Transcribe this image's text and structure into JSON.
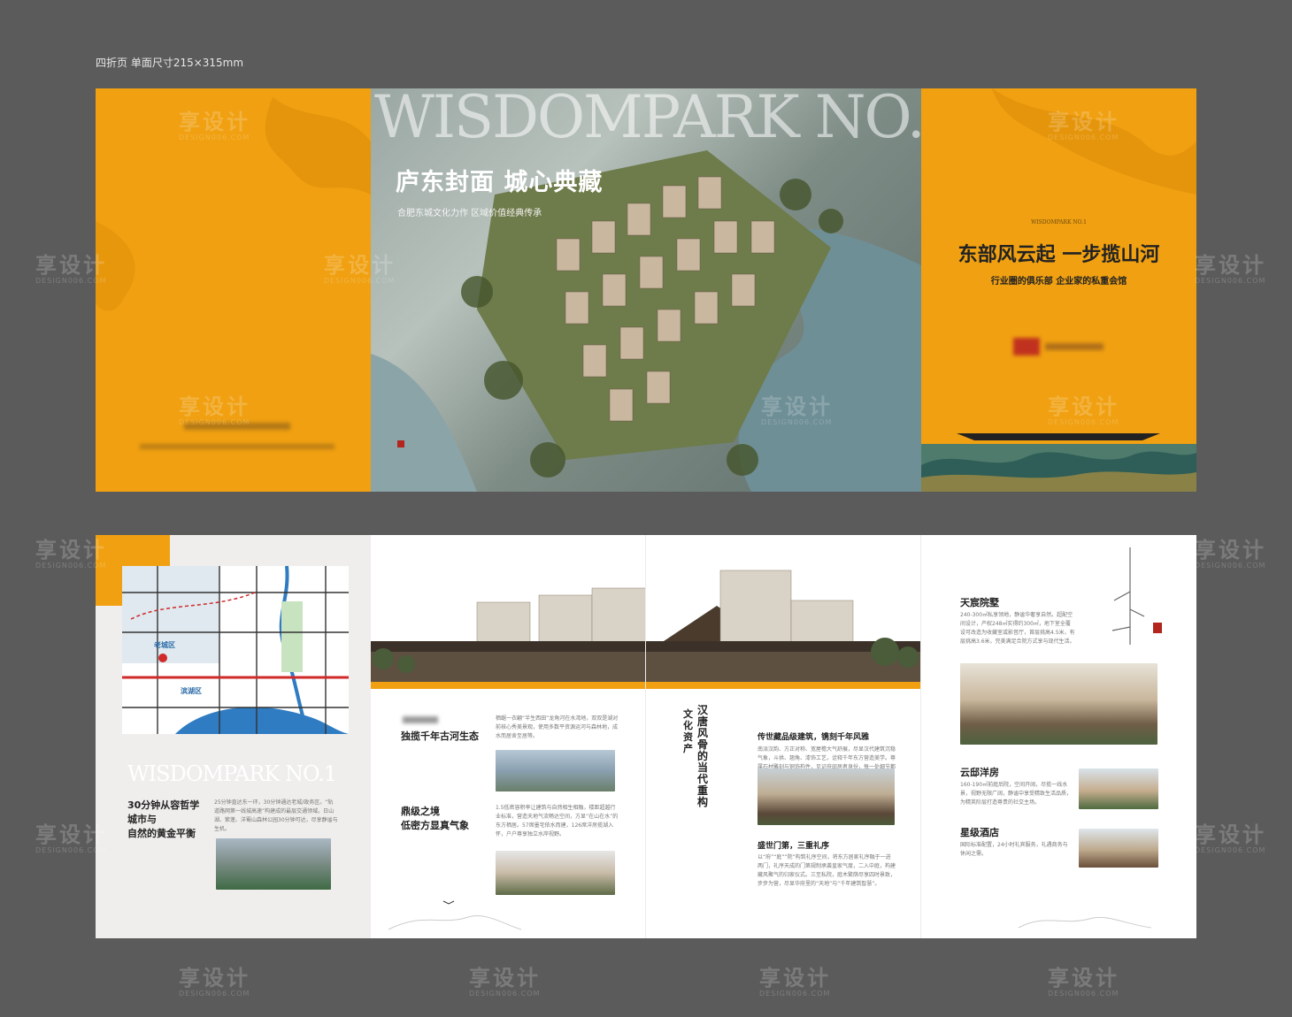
{
  "caption": "四折页 单面尺寸215×315mm",
  "watermark": {
    "text": "享设计",
    "sub": "DESIGN006.COM"
  },
  "cover": {
    "brand": "WISDOMPARK NO.1",
    "headline": "庐东封面 城心典藏",
    "subline": "合肥东城文化力作 区域价值经典传承"
  },
  "back_cover": {
    "small_brand": "WISDOMPARK NO.1",
    "headline": "东部风云起 一步揽山河",
    "subline": "行业圈的俱乐部 企业家的私重会馆"
  },
  "inside": {
    "map_panel": {
      "brand": "WISDOMPARK NO.1",
      "headline_lines": [
        "30分钟从容哲学",
        "城市与",
        "自然的黄金平衡"
      ],
      "paragraph": "25分钟直达东一环，30分钟通达老城/政务区。“轨道路网第一线城高速”构建成的最层交通领域。日山湖、紫蓬、洋蜀山森林公园30分钟可达，尽享静谧与生机。",
      "map_labels": [
        "老城区",
        "滨湖区"
      ]
    },
    "spread_left": {
      "eco_title": "独揽千年古河生态",
      "eco_text": "栖踞一衣翩“半生西田”龙角河在水湾地，双双是湖对前核心秀美景观，使用多数平资源运河与森林地，成水而居舍至居等。",
      "density_title_lines": [
        "鼎级之境",
        "低密方显真气象"
      ],
      "density_text": "1.5低密容积率让建筑与自然相生相融，楼距超越行业标准，营造天地气流畅达空间，方显“在山在水”的东方栖居。57席墨宅依水而建，126席洋房揽湖入怀，户户尊享独立水岸视野。"
    },
    "spread_right": {
      "vertical_title": "汉唐风骨的当代重构",
      "vertical_sub": "文化资产",
      "heritage_title": "传世藏品级建筑，镌刻千年风雅",
      "heritage_text": "南派汉韵、方正对称、宽屋檐大气舒展，尽显汉代建筑沉稳气象，斗拱、翘角、漆饰工艺，诠释千年东方营造美学。尊属石材雕刻与铜饰构件，见证府邸居者身份，每一处细节都蕴藏匠心与时间的积淀。",
      "gate_title": "盛世门第，三重礼序",
      "gate_text": "以“府”“庭”“院”构筑礼序空间，将东方居家礼序融于一进两门，礼序天成的门第规制承袭皇家气度，二入中庭，构建藏风聚气的归家仪式。三至私院，庭木繁荫尽享四时景致，步步为营，尽显华府里的“天地”与“千年建筑智慧”。"
    },
    "products_panel": {
      "villa_title": "天宸院墅",
      "villa_text": "240-300㎡私享领地，静谧华奢享自然。超配空间设计，产权248㎡实得约300㎡，地下室全覆设可改造为收藏室或影音厅，首层挑高4.5米，有层挑高3.6米，完美满足合院方式享与现代生活。",
      "house_title": "云邸洋房",
      "house_text": "160-190㎡前庭后院，空间开阔，尽揽一线水景，视野无限广阔，静谧中享受精致生活品质，为精英阶层打造尊贵的社交主场。",
      "hotel_title": "星级酒店",
      "hotel_text": "国际标准配置，24小时礼宾服务，礼遇商务与休闲之需。"
    }
  },
  "colors": {
    "orange": "#f0a011",
    "grey_bg": "#5b5b5b",
    "map_red": "#d02a2a",
    "water_blue": "#2f7cc2"
  }
}
